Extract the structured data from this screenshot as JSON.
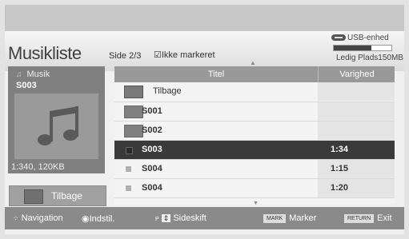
{
  "header": {
    "title": "Musikliste",
    "page_indicator": "Side 2/3",
    "checkbox_label": "Ikke markeret",
    "usb_label": "USB-enhed",
    "free_space": "Ledig Plads150MB",
    "usb_usage_fraction": 0.65
  },
  "preview": {
    "category": "Musik",
    "file_name": "S003",
    "meta": "1:340, 120KB"
  },
  "back_button": {
    "label": "Tilbage"
  },
  "list": {
    "columns": [
      "Titel",
      "Varighed"
    ],
    "back_row": "Tilbage",
    "rows": [
      {
        "name": "S001",
        "duration": "",
        "type": "folder"
      },
      {
        "name": "S002",
        "duration": "",
        "type": "folder"
      },
      {
        "name": "S003",
        "duration": "1:34",
        "type": "file",
        "selected": true
      },
      {
        "name": "S004",
        "duration": "1:15",
        "type": "file"
      },
      {
        "name": "S004",
        "duration": "1:20",
        "type": "file"
      }
    ]
  },
  "footer": {
    "navigation": "Navigation",
    "ok": "Indstil.",
    "page_key": "P",
    "page_change": "Sideskift",
    "mark_key": "MARK",
    "mark": "Marker",
    "return_key": "RETURN",
    "exit": "Exit"
  },
  "colors": {
    "selected_row": "#3a3a3a",
    "header_bar": "#999999",
    "footer": "#8a8a8a"
  }
}
